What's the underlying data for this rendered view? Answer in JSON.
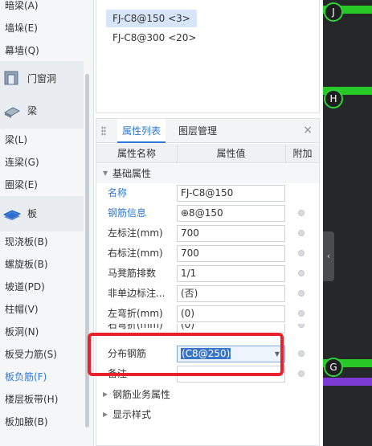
{
  "nav": {
    "items": [
      {
        "label": "暗梁(A)"
      },
      {
        "label": "墙垛(E)"
      },
      {
        "label": "幕墙(Q)"
      }
    ],
    "groups": [
      {
        "label": "门窗洞"
      },
      {
        "label": "梁"
      },
      {
        "label": "板"
      }
    ],
    "beam_items": [
      {
        "label": "梁(L)"
      },
      {
        "label": "连梁(G)"
      },
      {
        "label": "圈梁(E)"
      }
    ],
    "slab_items": [
      {
        "label": "现浇板(B)"
      },
      {
        "label": "螺旋板(B)"
      },
      {
        "label": "坡道(PD)"
      },
      {
        "label": "柱帽(V)"
      },
      {
        "label": "板洞(N)"
      },
      {
        "label": "板受力筋(S)"
      },
      {
        "label": "板负筋(F)"
      },
      {
        "label": "楼层板带(H)"
      },
      {
        "label": "板加腋(B)"
      }
    ]
  },
  "list": {
    "rows": [
      {
        "label": "FJ-C8@150 <3>"
      },
      {
        "label": "FJ-C8@300 <20>"
      }
    ]
  },
  "panel": {
    "tabs": [
      {
        "label": "属性列表"
      },
      {
        "label": "图层管理"
      }
    ],
    "close_icon": "×",
    "columns": {
      "name": "属性名称",
      "value": "属性值",
      "add": "附加"
    },
    "groups": {
      "basic": "基础属性",
      "business": "钢筋业务属性",
      "display": "显示样式"
    },
    "rows": [
      {
        "name": "名称",
        "value": "FJ-C8@150"
      },
      {
        "name": "钢筋信息",
        "value": "⊕8@150"
      },
      {
        "name": "左标注(mm)",
        "value": "700"
      },
      {
        "name": "右标注(mm)",
        "value": "700"
      },
      {
        "name": "马凳筋排数",
        "value": "1/1"
      },
      {
        "name": "非单边标注...",
        "value": "(否)"
      },
      {
        "name": "左弯折(mm)",
        "value": "(0)"
      },
      {
        "name": "右弯折(mm)",
        "value": "(0)"
      },
      {
        "name": "分布钢筋",
        "value": "(C8@250)"
      },
      {
        "name": "备注",
        "value": ""
      }
    ]
  },
  "canvas": {
    "axes": [
      {
        "label": "J"
      },
      {
        "label": "H"
      },
      {
        "label": "G"
      }
    ],
    "handle_icon": "‹"
  },
  "colors": {
    "accent": "#2f79d6",
    "annotation": "#e8212b",
    "grid_green": "#26c926",
    "canvas_bg": "#262728"
  }
}
